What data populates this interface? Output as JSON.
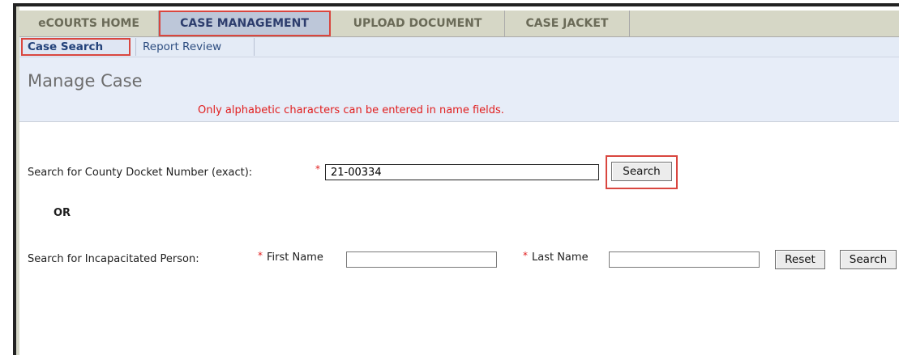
{
  "main_tabs": [
    {
      "label": "eCOURTS HOME"
    },
    {
      "label": "CASE MANAGEMENT"
    },
    {
      "label": "UPLOAD DOCUMENT"
    },
    {
      "label": "CASE JACKET"
    }
  ],
  "sub_tabs": [
    {
      "label": "Case Search"
    },
    {
      "label": "Report Review"
    }
  ],
  "page": {
    "title": "Manage Case",
    "warning": "Only alphabetic characters can be entered in name fields."
  },
  "docket_search": {
    "label": "Search for County Docket Number (exact):",
    "required_mark": "*",
    "value": "21-00334",
    "button": "Search"
  },
  "or_label": "OR",
  "person_search": {
    "label": "Search for Incapacitated Person:",
    "first_required": "*",
    "first_label": "First Name",
    "first_value": "",
    "last_required": "*",
    "last_label": "Last Name",
    "last_value": "",
    "reset_button": "Reset",
    "search_button": "Search"
  },
  "colors": {
    "active_tab": "#bdc7d9",
    "highlight": "#d9463f",
    "warning_text": "#e11d1d"
  }
}
